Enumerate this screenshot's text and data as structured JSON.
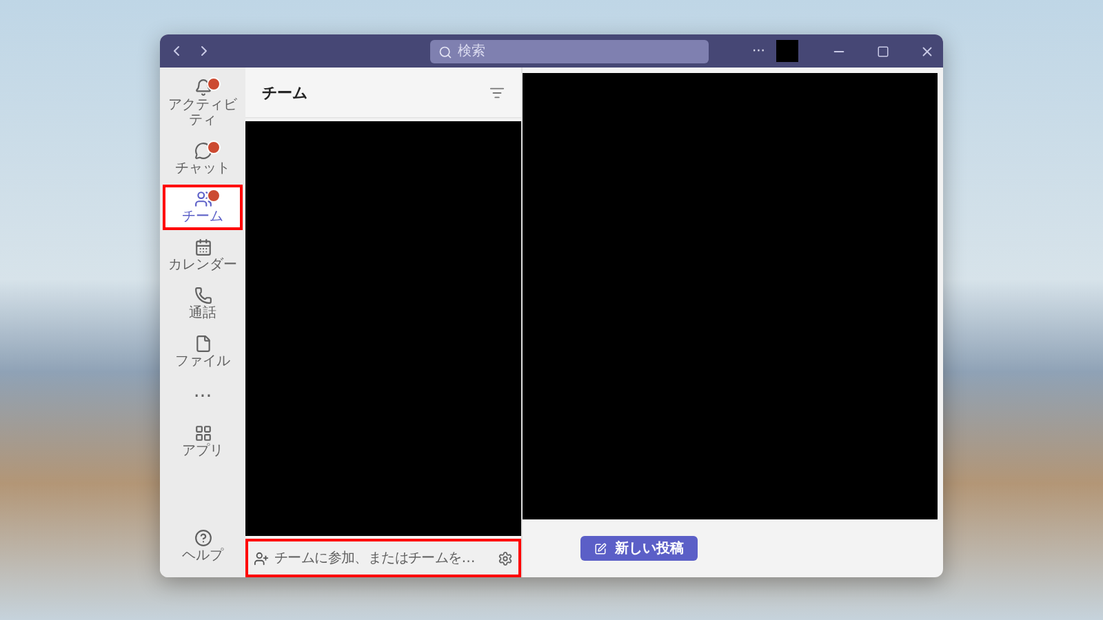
{
  "window": {
    "search": {
      "placeholder": "検索"
    },
    "more": "···"
  },
  "sidebar": {
    "items": [
      {
        "kind": "bell",
        "label": "アクティビティ",
        "selected": false,
        "badge": true,
        "highlighted": false
      },
      {
        "kind": "chat",
        "label": "チャット",
        "selected": false,
        "badge": true,
        "highlighted": false
      },
      {
        "kind": "teams",
        "label": "チーム",
        "selected": true,
        "badge": true,
        "highlighted": true
      },
      {
        "kind": "calendar",
        "label": "カレンダー",
        "selected": false,
        "badge": false,
        "highlighted": false
      },
      {
        "kind": "phone",
        "label": "通話",
        "selected": false,
        "badge": false,
        "highlighted": false
      },
      {
        "kind": "file",
        "label": "ファイル",
        "selected": false,
        "badge": false,
        "highlighted": false
      },
      {
        "kind": "more",
        "label": "···",
        "selected": false,
        "badge": false,
        "highlighted": false
      },
      {
        "kind": "apps",
        "label": "アプリ",
        "selected": false,
        "badge": false,
        "highlighted": false
      }
    ],
    "help": {
      "label": "ヘルプ"
    }
  },
  "team_panel": {
    "title": "チーム",
    "join": {
      "label": "チームに参加、またはチームを…",
      "highlighted": true
    }
  },
  "main": {
    "new_post": "新しい投稿"
  }
}
